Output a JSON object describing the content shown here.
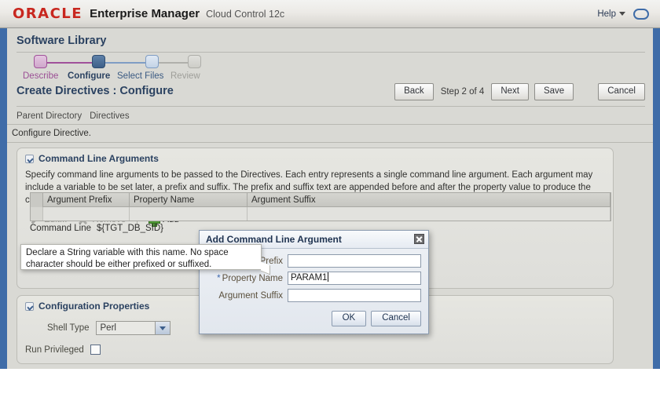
{
  "brand": {
    "logo": "ORACLE",
    "product": "Enterprise Manager",
    "edition": "Cloud Control 12c",
    "help_label": "Help",
    "accent_blue": "#3f6ca8",
    "oracle_red": "#c8271f"
  },
  "page": {
    "title": "Software Library",
    "heading": "Create Directives : Configure",
    "instruction": "Configure Directive."
  },
  "train": {
    "steps": [
      {
        "label": "Describe",
        "state": "visited",
        "color": "#a0519a"
      },
      {
        "label": "Configure",
        "state": "current",
        "color": "#46698f"
      },
      {
        "label": "Select Files",
        "state": "next",
        "color": "#7f9dc4"
      },
      {
        "label": "Review",
        "state": "disabled",
        "color": "#a8a8a3"
      }
    ]
  },
  "toolbar": {
    "back_label": "Back",
    "step_text": "Step 2 of 4",
    "next_label": "Next",
    "save_label": "Save",
    "cancel_label": "Cancel"
  },
  "breadcrumb": {
    "items": [
      "Parent Directory",
      "Directives"
    ]
  },
  "command_line_args": {
    "section_title": "Command Line Arguments",
    "description": "Specify command line arguments to be passed to the Directives. Each entry represents a single command line argument. Each argument may include a variable to be set later, a prefix and suffix. The prefix and suffix text are appended before and after the property value to produce the command line argument.",
    "actions": {
      "edit_label": "Edit...",
      "remove_label": "Remove",
      "add_label": "Add"
    },
    "table": {
      "columns": [
        "Argument Prefix",
        "Property Name",
        "Argument Suffix"
      ],
      "rows": []
    },
    "command_line_label": "Command Line",
    "command_line_value": "${TGT_DB_SID}"
  },
  "configuration_properties": {
    "section_title": "Configuration Properties",
    "shell_type_label": "Shell Type",
    "shell_type_value": "Perl",
    "run_privileged_label": "Run Privileged",
    "run_privileged_checked": false
  },
  "dialog": {
    "title": "Add Command Line Argument",
    "fields": [
      {
        "label": "Argument Prefix",
        "value": "",
        "required": false
      },
      {
        "label": "Property Name",
        "value": "PARAM1",
        "required": true
      },
      {
        "label": "Argument Suffix",
        "value": "",
        "required": false
      }
    ],
    "ok_label": "OK",
    "cancel_label": "Cancel"
  },
  "tooltip": {
    "text": "Declare a String variable with this name. No space character should be either prefixed or suffixed."
  }
}
